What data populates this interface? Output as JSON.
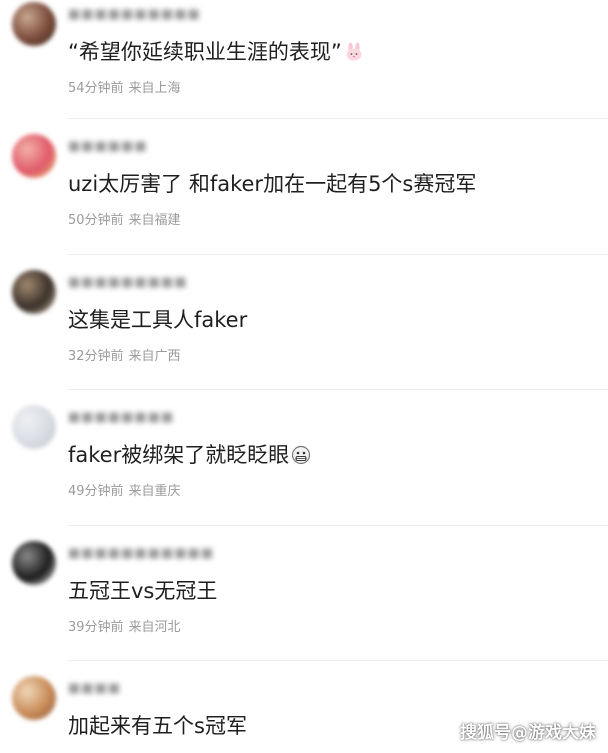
{
  "comments": [
    {
      "username": "■■■■■■■■■■",
      "content": "“希望你延续职业生涯的表现”",
      "emoji": "rabbit-face-icon",
      "time": "54分钟前",
      "location": "来自上海",
      "avatar_colors": [
        "#7a4a3a",
        "#c8a890",
        "#3a2a22"
      ]
    },
    {
      "username": "■■■■■■",
      "content": "uzi太厉害了 和faker加在一起有5个s赛冠军",
      "emoji": "",
      "time": "50分钟前",
      "location": "来自福建",
      "avatar_colors": [
        "#e05a6a",
        "#f3b0a8",
        "#e8c870"
      ]
    },
    {
      "username": "■■■■■■■■■",
      "content": "这集是工具人faker",
      "emoji": "",
      "time": "32分钟前",
      "location": "来自广西",
      "avatar_colors": [
        "#3a3028",
        "#a08870",
        "#d8c8b0"
      ]
    },
    {
      "username": "■■■■■■■■",
      "content": "faker被绑架了就眨眨眼",
      "emoji": "grimacing-face-icon",
      "time": "49分钟前",
      "location": "来自重庆",
      "avatar_colors": [
        "#d8dce2",
        "#eef0f3",
        "#c0c6ce"
      ]
    },
    {
      "username": "■■■■■■■■■■■",
      "content": "五冠王vs无冠王",
      "emoji": "",
      "time": "39分钟前",
      "location": "来自河北",
      "avatar_colors": [
        "#1c1c1c",
        "#8a8a8a",
        "#f2f2f2"
      ]
    },
    {
      "username": "■■■■",
      "content": "加起来有五个s冠军",
      "emoji": "",
      "time": "",
      "location": "",
      "avatar_colors": [
        "#c88a58",
        "#f0d8b8",
        "#8a5a3a"
      ]
    }
  ],
  "watermark": "搜狐号@游戏大妹"
}
